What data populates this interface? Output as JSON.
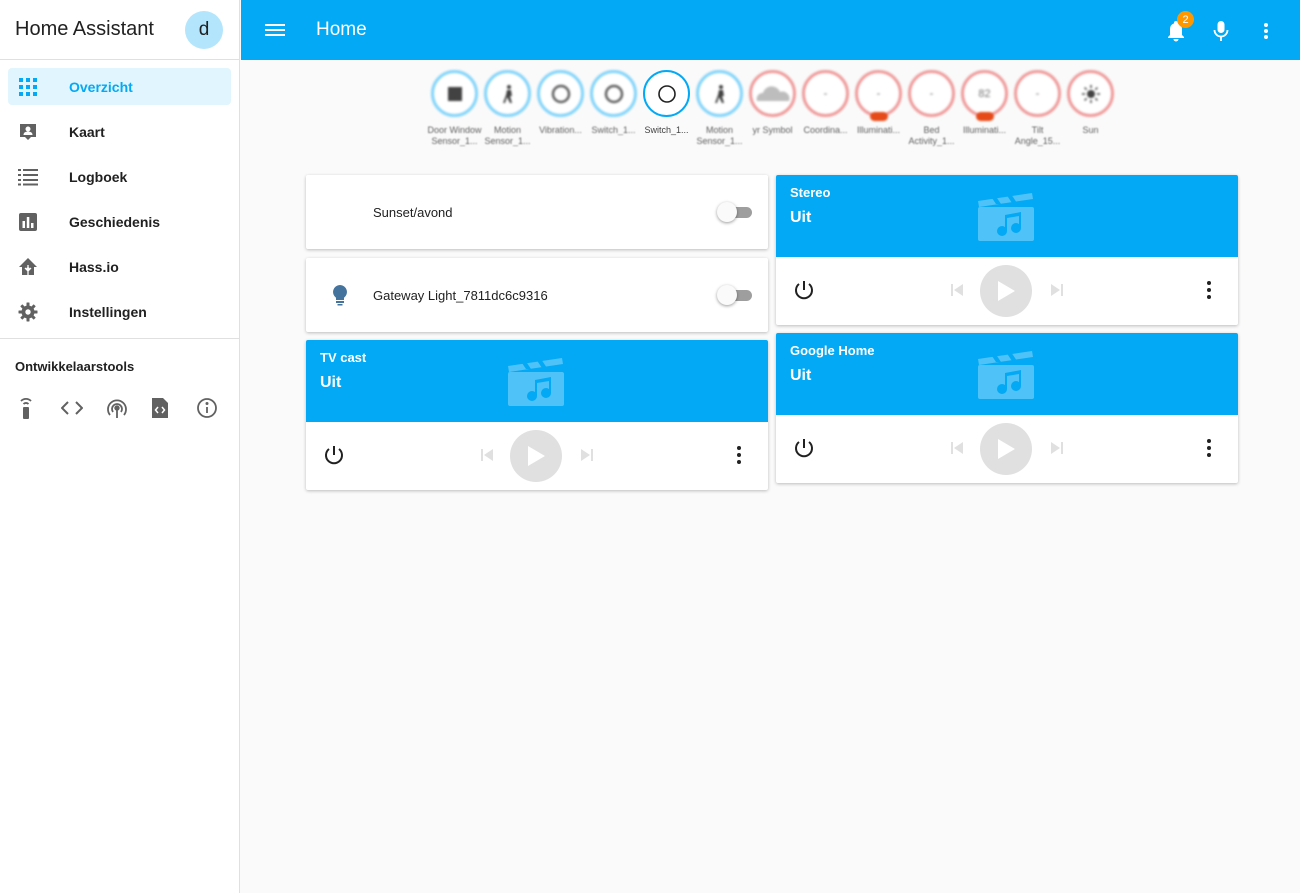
{
  "sidebar": {
    "title": "Home Assistant",
    "avatar_letter": "d",
    "items": [
      {
        "label": "Overzicht",
        "icon": "grid-icon"
      },
      {
        "label": "Kaart",
        "icon": "map-account-icon"
      },
      {
        "label": "Logboek",
        "icon": "list-icon"
      },
      {
        "label": "Geschiedenis",
        "icon": "chart-icon"
      },
      {
        "label": "Hass.io",
        "icon": "home-assistant-icon"
      },
      {
        "label": "Instellingen",
        "icon": "gear-icon"
      }
    ],
    "dev_title": "Ontwikkelaarstools",
    "dev_tools": [
      "remote-icon",
      "code-brackets-icon",
      "broadcast-icon",
      "file-code-icon",
      "info-icon"
    ]
  },
  "topbar": {
    "title": "Home",
    "notification_count": "2"
  },
  "badges": [
    {
      "value": "",
      "label": "Door Window Sensor_1...",
      "tone": "blue"
    },
    {
      "value": "",
      "label": "Motion Sensor_1...",
      "tone": "blue"
    },
    {
      "value": "",
      "label": "Vibration...",
      "tone": "blue"
    },
    {
      "value": "",
      "label": "Switch_1...",
      "tone": "blue"
    },
    {
      "value": "",
      "label": "Switch_1...",
      "tone": "blue"
    },
    {
      "value": "",
      "label": "Motion Sensor_1...",
      "tone": "blue"
    },
    {
      "value": "",
      "label": "yr Symbol",
      "tone": "orange"
    },
    {
      "value": "-",
      "label": "Coordina...",
      "tone": "orange"
    },
    {
      "value": "-",
      "label": "Illuminati...",
      "tone": "orange"
    },
    {
      "value": "-",
      "label": "Bed Activity_1...",
      "tone": "orange"
    },
    {
      "value": "82",
      "label": "Illuminati...",
      "tone": "orange"
    },
    {
      "value": "-",
      "label": "Tilt Angle_15...",
      "tone": "orange"
    },
    {
      "value": "",
      "label": "Sun",
      "tone": "orange"
    }
  ],
  "entities": [
    {
      "name": "Sunset/avond"
    },
    {
      "name": "Gateway Light_7811dc6c9316"
    }
  ],
  "media": [
    {
      "name": "TV cast",
      "state": "Uit"
    },
    {
      "name": "Stereo",
      "state": "Uit"
    },
    {
      "name": "Google Home",
      "state": "Uit"
    }
  ],
  "colors": {
    "primary": "#03a9f4",
    "accent": "#ff9800",
    "active_bg": "#e1f5fe"
  }
}
